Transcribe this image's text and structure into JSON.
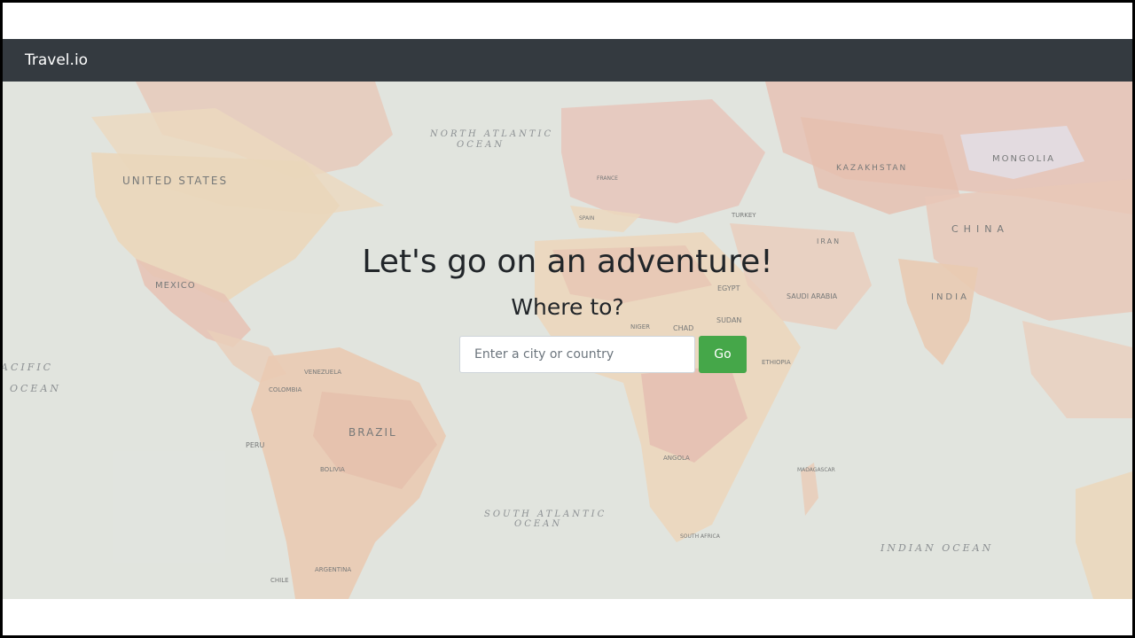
{
  "navbar": {
    "brand": "Travel.io"
  },
  "hero": {
    "title": "Let's go on an adventure!",
    "subtitle": "Where to?",
    "search": {
      "placeholder": "Enter a city or country",
      "value": "",
      "button_label": "Go"
    },
    "map_labels": {
      "united_states": "UNITED STATES",
      "mexico": "MEXICO",
      "brazil": "BRAZIL",
      "peru": "PERU",
      "colombia": "COLOMBIA",
      "venezuela": "VENEZUELA",
      "bolivia": "BOLIVIA",
      "argentina": "ARGENTINA",
      "chile": "CHILE",
      "kazakhstan": "KAZAKHSTAN",
      "mongolia": "MONGOLIA",
      "china": "CHINA",
      "india": "INDIA",
      "iran": "IRAN",
      "egypt": "EGYPT",
      "saudi_arabia": "SAUDI ARABIA",
      "sudan": "SUDAN",
      "chad": "CHAD",
      "niger": "NIGER",
      "ethiopia": "ETHIOPIA",
      "angola": "ANGOLA",
      "south_africa": "SOUTH AFRICA",
      "madagascar": "MADAGASCAR",
      "turkey": "TURKEY",
      "spain": "SPAIN",
      "france": "FRANCE",
      "north_atlantic_ocean": [
        "NORTH ATLANTIC",
        "OCEAN"
      ],
      "south_atlantic_ocean": [
        "SOUTH ATLANTIC",
        "OCEAN"
      ],
      "pacific_ocean": [
        "ACIFIC",
        "OCEAN"
      ],
      "indian_ocean": "INDIAN OCEAN"
    }
  },
  "colors": {
    "navbar_bg": "#343a40",
    "go_button": "#45a749",
    "ocean": "#dfe2dc",
    "land_beige": "#ecd4b5",
    "land_pink": "#e4b3a6"
  }
}
